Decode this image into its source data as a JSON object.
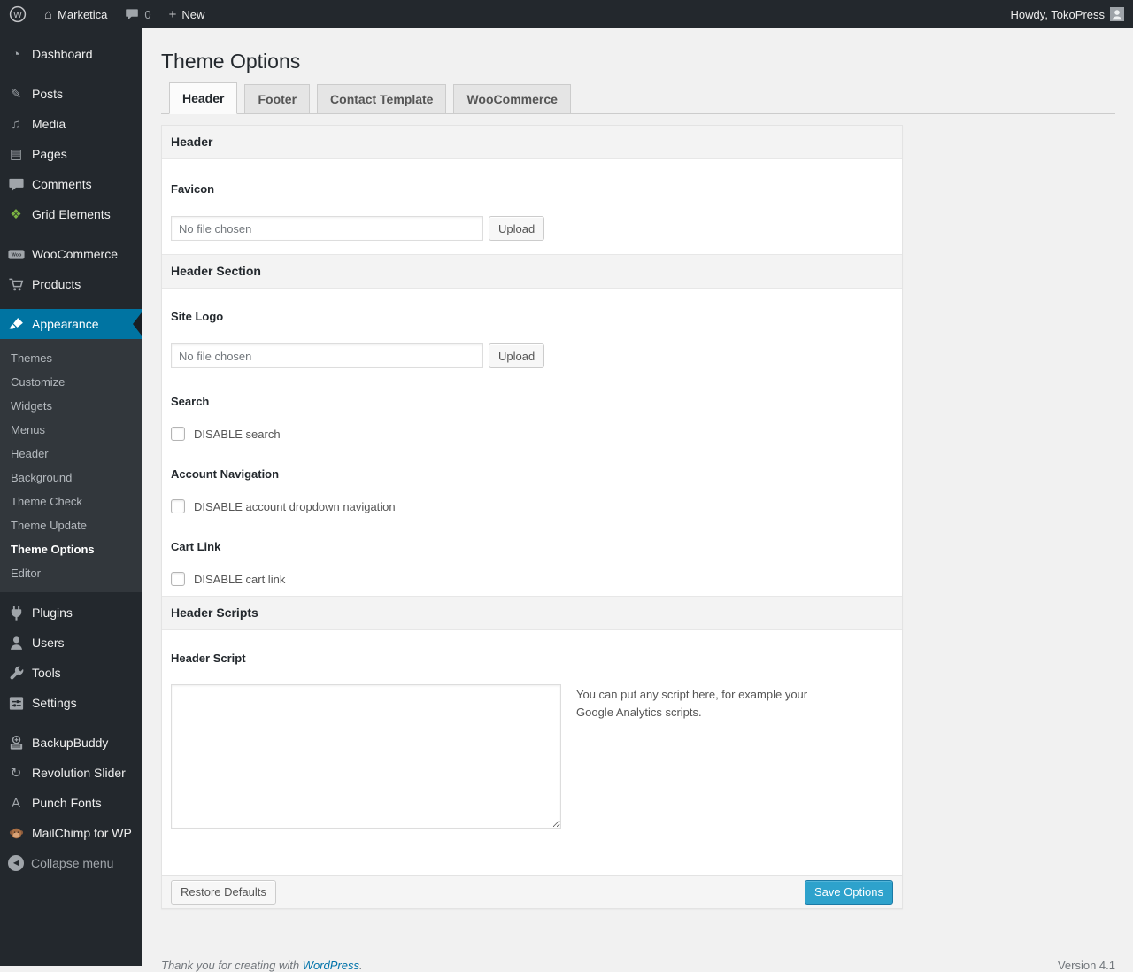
{
  "top_bar": {
    "site_name": "Marketica",
    "comments_count": "0",
    "plus_glyph": "+",
    "new_label": "New",
    "howdy": "Howdy, TokoPress"
  },
  "sidebar": {
    "groups": [
      {
        "items": [
          {
            "id": "dashboard",
            "icon": "dashboard-icon",
            "label": "Dashboard"
          }
        ]
      },
      {
        "items": [
          {
            "id": "posts",
            "icon": "posts-icon",
            "label": "Posts"
          },
          {
            "id": "media",
            "icon": "media-icon",
            "label": "Media"
          },
          {
            "id": "pages",
            "icon": "pages-icon",
            "label": "Pages"
          },
          {
            "id": "comments",
            "icon": "comments-icon",
            "label": "Comments"
          },
          {
            "id": "grid-elements",
            "icon": "grid-elements-icon",
            "label": "Grid Elements"
          }
        ]
      },
      {
        "items": [
          {
            "id": "woocommerce",
            "icon": "woocommerce-icon",
            "label": "WooCommerce"
          },
          {
            "id": "products",
            "icon": "products-icon",
            "label": "Products"
          }
        ]
      },
      {
        "items": [
          {
            "id": "appearance",
            "icon": "appearance-icon",
            "label": "Appearance",
            "active": true,
            "submenu": [
              "Themes",
              "Customize",
              "Widgets",
              "Menus",
              "Header",
              "Background",
              "Theme Check",
              "Theme Update",
              "Theme Options",
              "Editor"
            ],
            "submenu_current": "Theme Options"
          }
        ]
      },
      {
        "items": [
          {
            "id": "plugins",
            "icon": "plugins-icon",
            "label": "Plugins"
          },
          {
            "id": "users",
            "icon": "users-icon",
            "label": "Users"
          },
          {
            "id": "tools",
            "icon": "tools-icon",
            "label": "Tools"
          },
          {
            "id": "settings",
            "icon": "settings-icon",
            "label": "Settings"
          }
        ]
      },
      {
        "items": [
          {
            "id": "backupbuddy",
            "icon": "backupbuddy-icon",
            "label": "BackupBuddy"
          },
          {
            "id": "revolution-slider",
            "icon": "revolution-slider-icon",
            "label": "Revolution Slider"
          },
          {
            "id": "punch-fonts",
            "icon": "punch-fonts-icon",
            "label": "Punch Fonts"
          },
          {
            "id": "mailchimp",
            "icon": "mailchimp-icon",
            "label": "MailChimp for WP"
          }
        ]
      },
      {
        "items": [
          {
            "id": "collapse-menu",
            "icon": "collapse-icon",
            "label": "Collapse menu",
            "muted": true
          }
        ]
      }
    ]
  },
  "icon_glyphs": {
    "home-icon": "⌂",
    "dashboard-icon": "◔",
    "posts-icon": "✎",
    "media-icon": "♫",
    "pages-icon": "▤",
    "grid-elements-icon": "❖",
    "revolution-slider-icon": "↻",
    "punch-fonts-icon": "A",
    "collapse-icon": "◀"
  },
  "page": {
    "title": "Theme Options"
  },
  "tabs": [
    {
      "label": "Header",
      "active": true
    },
    {
      "label": "Footer",
      "active": false
    },
    {
      "label": "Contact Template",
      "active": false
    },
    {
      "label": "WooCommerce",
      "active": false
    }
  ],
  "panel": {
    "section_header": {
      "title": "Header"
    },
    "favicon": {
      "label": "Favicon",
      "file_text": "No file chosen",
      "upload_label": "Upload"
    },
    "section_header_section": {
      "title": "Header Section"
    },
    "site_logo": {
      "label": "Site Logo",
      "file_text": "No file chosen",
      "upload_label": "Upload"
    },
    "search": {
      "label": "Search",
      "checkbox_label": "DISABLE search",
      "checked": false
    },
    "account_navigation": {
      "label": "Account Navigation",
      "checkbox_label": "DISABLE account dropdown navigation",
      "checked": false
    },
    "cart_link": {
      "label": "Cart Link",
      "checkbox_label": "DISABLE cart link",
      "checked": false
    },
    "section_header_scripts": {
      "title": "Header Scripts"
    },
    "header_script": {
      "label": "Header Script",
      "value": "",
      "description": "You can put any script here, for example your Google Analytics scripts."
    },
    "footer_bar": {
      "restore_label": "Restore Defaults",
      "save_label": "Save Options"
    }
  },
  "footer": {
    "thanks_text": "Thank you for creating with",
    "wordpress_link": "WordPress",
    "thanks_suffix": ".",
    "version": "Version 4.1"
  },
  "colors": {
    "sidebar_bg": "#23282d",
    "active_blue": "#0074a2",
    "primary_button": "#2ea2cc",
    "link_blue": "#0073aa",
    "page_bg": "#f1f1f1"
  }
}
